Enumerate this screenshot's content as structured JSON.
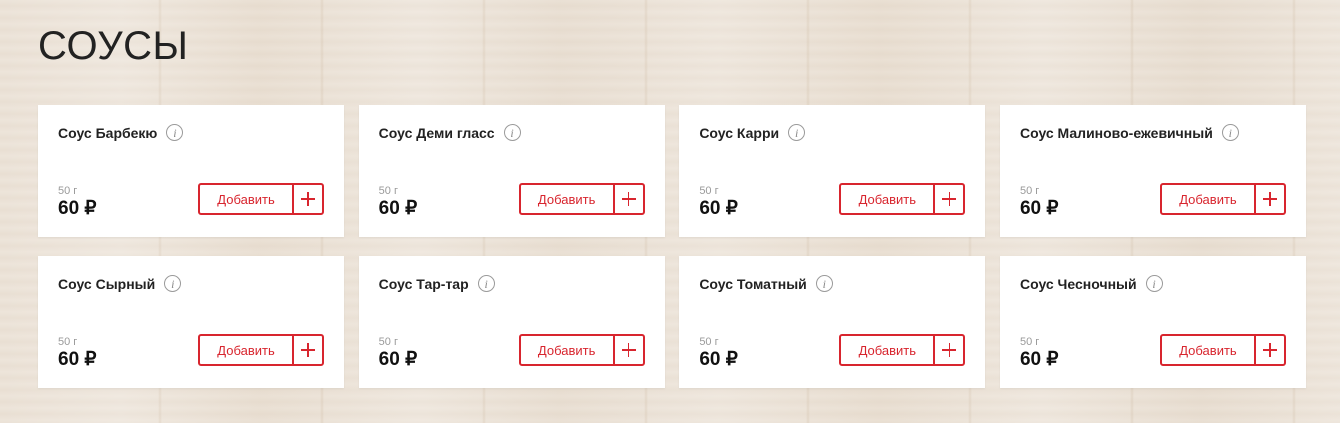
{
  "page": {
    "title": "СОУСЫ"
  },
  "colors": {
    "accent": "#d8252e",
    "text": "#222222",
    "muted": "#9a9a9a",
    "card_bg": "#ffffff"
  },
  "icons": {
    "info": "info-icon",
    "plus": "plus-icon"
  },
  "products": [
    {
      "name": "Соус Барбекю",
      "weight": "50 г",
      "price": "60 ₽",
      "add_label": "Добавить"
    },
    {
      "name": "Соус Деми гласс",
      "weight": "50 г",
      "price": "60 ₽",
      "add_label": "Добавить"
    },
    {
      "name": "Соус Карри",
      "weight": "50 г",
      "price": "60 ₽",
      "add_label": "Добавить"
    },
    {
      "name": "Соус Малиново-ежевичный",
      "weight": "50 г",
      "price": "60 ₽",
      "add_label": "Добавить"
    },
    {
      "name": "Соус Сырный",
      "weight": "50 г",
      "price": "60 ₽",
      "add_label": "Добавить"
    },
    {
      "name": "Соус Тар-тар",
      "weight": "50 г",
      "price": "60 ₽",
      "add_label": "Добавить"
    },
    {
      "name": "Соус Томатный",
      "weight": "50 г",
      "price": "60 ₽",
      "add_label": "Добавить"
    },
    {
      "name": "Соус Чесночный",
      "weight": "50 г",
      "price": "60 ₽",
      "add_label": "Добавить"
    }
  ]
}
